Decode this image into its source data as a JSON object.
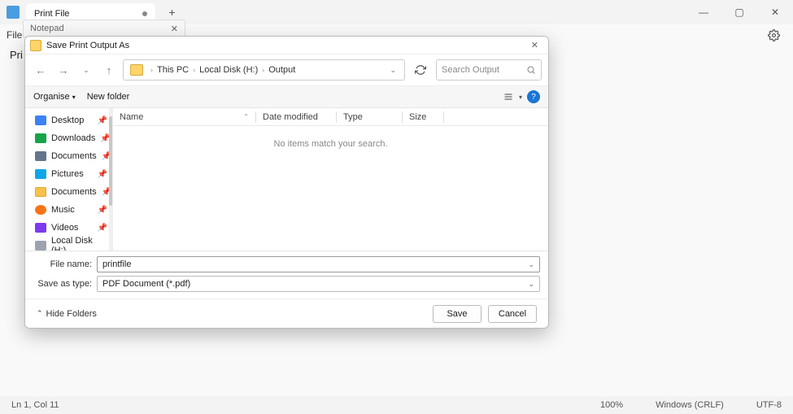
{
  "window": {
    "tab_title": "Print File",
    "second_header": "Notepad",
    "menu_file": "File",
    "content_preview": "Pri",
    "controls": {
      "min": "—",
      "max": "▢",
      "close": "✕"
    }
  },
  "statusbar": {
    "pos": "Ln 1, Col 11",
    "zoom": "100%",
    "eol": "Windows (CRLF)",
    "encoding": "UTF-8"
  },
  "dialog": {
    "title": "Save Print Output As",
    "breadcrumb": [
      "This PC",
      "Local Disk (H:)",
      "Output"
    ],
    "search_placeholder": "Search Output",
    "toolbar": {
      "organise": "Organise",
      "newfolder": "New folder"
    },
    "sidebar": [
      {
        "label": "Desktop",
        "icon": "ic-desktop",
        "pin": true
      },
      {
        "label": "Downloads",
        "icon": "ic-down",
        "pin": true
      },
      {
        "label": "Documents",
        "icon": "ic-doc",
        "pin": true
      },
      {
        "label": "Pictures",
        "icon": "ic-pic",
        "pin": true
      },
      {
        "label": "Documents",
        "icon": "ic-folder",
        "pin": true
      },
      {
        "label": "Music",
        "icon": "ic-music",
        "pin": true
      },
      {
        "label": "Videos",
        "icon": "ic-video",
        "pin": true
      },
      {
        "label": "Local Disk (H:)",
        "icon": "ic-disk",
        "pin": false
      }
    ],
    "columns": {
      "name": "Name",
      "date": "Date modified",
      "type": "Type",
      "size": "Size"
    },
    "empty": "No items match your search.",
    "filename_label": "File name:",
    "filename_value": "printfile",
    "savetype_label": "Save as type:",
    "savetype_value": "PDF Document (*.pdf)",
    "hide_folders": "Hide Folders",
    "save_btn": "Save",
    "cancel_btn": "Cancel"
  }
}
